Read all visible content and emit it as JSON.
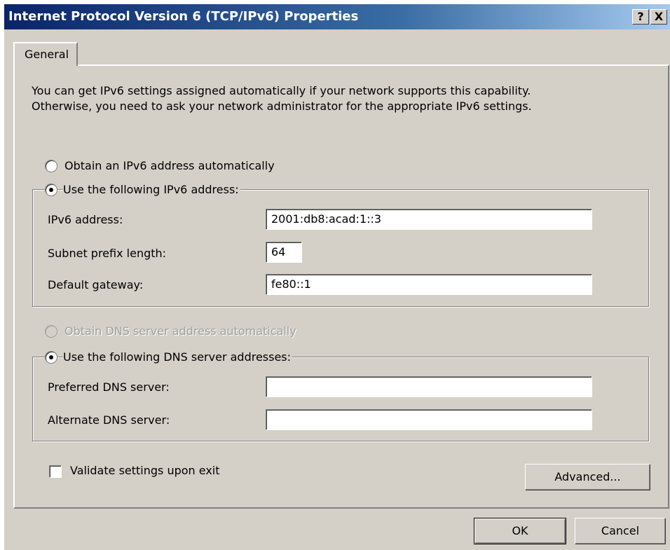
{
  "window": {
    "title": "Internet Protocol Version 6 (TCP/IPv6) Properties",
    "help_button": "?",
    "close_button": "X"
  },
  "tabs": [
    {
      "label": "General",
      "selected": true
    }
  ],
  "general": {
    "intro_line1": "You can get IPv6 settings assigned automatically if your network supports this capability.",
    "intro_line2": "Otherwise, you need to ask your network administrator for the appropriate IPv6 settings.",
    "address_mode": {
      "auto_label": "Obtain an IPv6 address automatically",
      "manual_label": "Use the following IPv6 address:",
      "selected": "manual"
    },
    "ipv6_address": {
      "label": "IPv6 address:",
      "value": "2001:db8:acad:1::3"
    },
    "subnet_prefix": {
      "label": "Subnet prefix length:",
      "value": "64"
    },
    "default_gateway": {
      "label": "Default gateway:",
      "value": "fe80::1"
    },
    "dns_mode": {
      "auto_label": "Obtain DNS server address automatically",
      "auto_enabled": false,
      "manual_label": "Use the following DNS server addresses:",
      "selected": "manual"
    },
    "preferred_dns": {
      "label": "Preferred DNS server:",
      "value": ""
    },
    "alternate_dns": {
      "label": "Alternate DNS server:",
      "value": ""
    },
    "validate": {
      "label": "Validate settings upon exit",
      "checked": false
    },
    "advanced_button": "Advanced..."
  },
  "footer": {
    "ok_label": "OK",
    "cancel_label": "Cancel"
  },
  "colors": {
    "dialog_bg": "#d4d0c8",
    "title_start": "#0a246a",
    "title_end": "#a6caf0"
  }
}
